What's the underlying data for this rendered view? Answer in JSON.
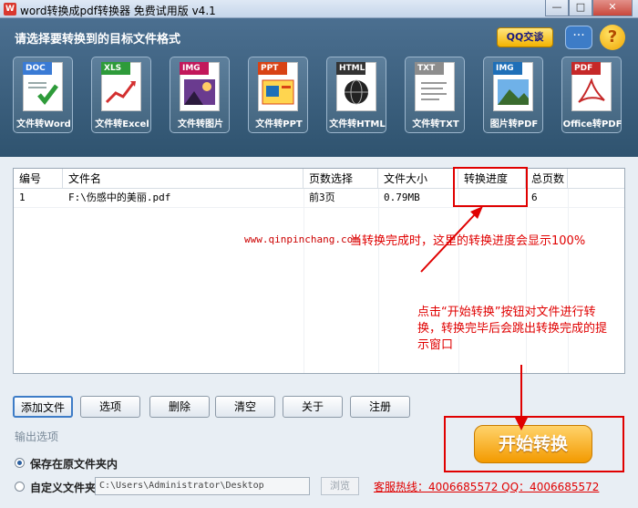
{
  "window": {
    "title": "word转换成pdf转换器 免费试用版 v4.1",
    "icon_glyph": "W",
    "controls": {
      "minimize": "—",
      "maximize": "□",
      "close": "✕"
    }
  },
  "header": {
    "prompt": "请选择要转换到的目标文件格式",
    "qq_label": "QQ交谈",
    "chat_glyph": "···",
    "help_glyph": "?"
  },
  "formats": [
    {
      "tag": "DOC",
      "caption": "文件转Word",
      "color": "#3a7bd5"
    },
    {
      "tag": "XLS",
      "caption": "文件转Excel",
      "color": "#2e9b3a"
    },
    {
      "tag": "IMG",
      "caption": "文件转图片",
      "color": "#c2185b"
    },
    {
      "tag": "PPT",
      "caption": "文件转PPT",
      "color": "#d84315"
    },
    {
      "tag": "HTML",
      "caption": "文件转HTML",
      "color": "#333333"
    },
    {
      "tag": "TXT",
      "caption": "文件转TXT",
      "color": "#8d8d8d"
    },
    {
      "tag": "IMG",
      "caption": "图片转PDF",
      "color": "#1e6fb8"
    },
    {
      "tag": "PDF",
      "caption": "Office转PDF",
      "color": "#c62828"
    }
  ],
  "table": {
    "columns": [
      "编号",
      "文件名",
      "页数选择",
      "文件大小",
      "转换进度",
      "总页数"
    ],
    "rows": [
      [
        "1",
        "F:\\伤感中的美丽.pdf",
        "前3页",
        "0.79MB",
        "",
        "6"
      ]
    ]
  },
  "annotations": {
    "watermark": "www.qinpinchang.com",
    "note1": "当转换完成时，这里的转换进度会显示100%",
    "note2": "点击“开始转换”按钮对文件进行转换，转换完毕后会跳出转换完成的提示窗口"
  },
  "buttons": {
    "add_file": "添加文件",
    "options": "选项",
    "delete": "删除",
    "clear": "清空",
    "about": "关于",
    "register": "注册"
  },
  "output": {
    "section_label": "输出选项",
    "option_original": "保存在原文件夹内",
    "option_custom": "自定义文件夹",
    "selected": "original",
    "path_value": "C:\\Users\\Administrator\\Desktop",
    "browse_label": "浏览"
  },
  "hotline": "客服热线：4006685572 QQ：4006685572",
  "start_button": "开始转换"
}
